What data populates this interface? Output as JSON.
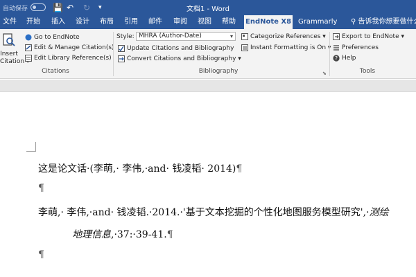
{
  "titlebar": {
    "autosave_label": "自动保存",
    "doc_title": "文档1 - Word",
    "save_glyph": "💾",
    "undo_glyph": "↶",
    "redo_glyph": "↻",
    "customize_glyph": "▾"
  },
  "tabs": [
    "文件",
    "开始",
    "插入",
    "设计",
    "布局",
    "引用",
    "邮件",
    "审阅",
    "视图",
    "帮助",
    "EndNote X8",
    "Grammarly"
  ],
  "tell_me": "告诉我你想要做什么",
  "ribbon": {
    "insert_citation": [
      "Insert",
      "Citation ▾"
    ],
    "go_to_endnote": "Go to EndNote",
    "edit_manage": "Edit & Manage Citation(s)",
    "edit_library": "Edit Library Reference(s)",
    "style_label": "Style:",
    "style_value": "MHRA (Author-Date)",
    "update_citations": "Update Citations and Bibliography",
    "convert_citations": "Convert Citations and Bibliography ▾",
    "categorize": "Categorize References ▾",
    "instant_formatting": "Instant Formatting is On ▾",
    "export": "Export to EndNote ▾",
    "preferences": "Preferences",
    "help": "Help",
    "groups": {
      "citations": "Citations",
      "bibliography": "Bibliography",
      "tools": "Tools"
    }
  },
  "document": {
    "line1": "这是论文话·(李萌,· 李伟,·and· 钱凌韬· 2014)",
    "pilcrow": "¶",
    "ref_line1": "李萌,· 李伟,·and· 钱凌韬.·2014.·'基于文本挖掘的个性化地图服务模型研究',·",
    "ref_journal_start": "测绘",
    "ref_line2_journal": "地理信息",
    "ref_line2_rest": ",·37:·39-41."
  }
}
